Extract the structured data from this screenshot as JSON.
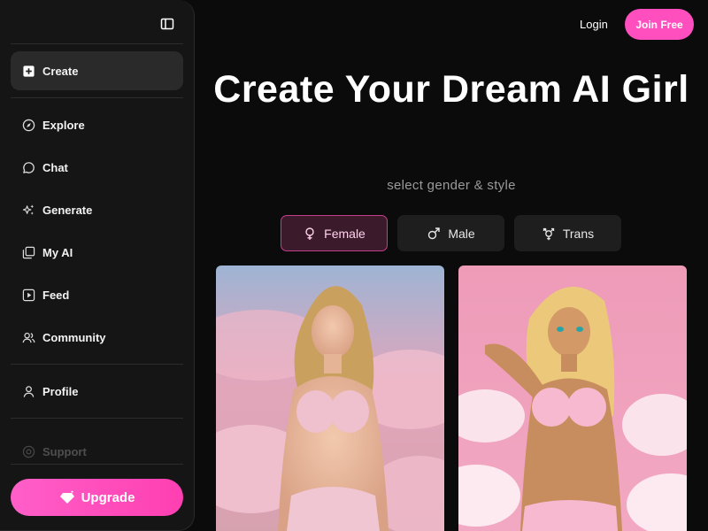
{
  "sidebar": {
    "items": [
      {
        "label": "Create",
        "icon": "plus-square-icon"
      },
      {
        "label": "Explore",
        "icon": "compass-icon"
      },
      {
        "label": "Chat",
        "icon": "chat-bubble-icon"
      },
      {
        "label": "Generate",
        "icon": "sparkles-icon"
      },
      {
        "label": "My AI",
        "icon": "stacked-cards-icon"
      },
      {
        "label": "Feed",
        "icon": "play-square-icon"
      },
      {
        "label": "Community",
        "icon": "users-icon"
      },
      {
        "label": "Profile",
        "icon": "user-icon"
      },
      {
        "label": "Support",
        "icon": "support-icon"
      }
    ],
    "upgrade_label": "Upgrade"
  },
  "header": {
    "login_label": "Login",
    "join_label": "Join Free"
  },
  "hero": {
    "title": "Create Your Dream AI Girl",
    "subtitle": "select gender & style"
  },
  "gender_tabs": [
    {
      "label": "Female",
      "icon": "female-symbol-icon",
      "selected": true
    },
    {
      "label": "Male",
      "icon": "male-symbol-icon",
      "selected": false
    },
    {
      "label": "Trans",
      "icon": "transgender-symbol-icon",
      "selected": false
    }
  ],
  "colors": {
    "accent": "#ff4fbf",
    "background": "#0b0b0b",
    "sidebar": "#151515"
  }
}
